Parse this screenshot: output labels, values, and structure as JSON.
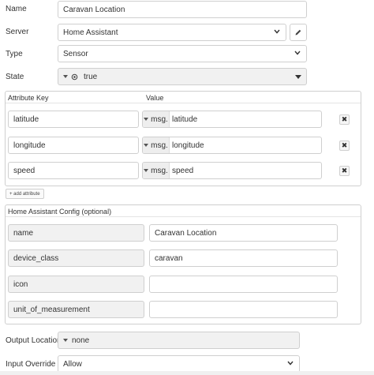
{
  "form": {
    "name_label": "Name",
    "name_value": "Caravan Location",
    "server_label": "Server",
    "server_value": "Home Assistant",
    "type_label": "Type",
    "type_value": "Sensor",
    "state_label": "State",
    "state_value": "true"
  },
  "attributes": {
    "col_key": "Attribute Key",
    "col_value": "Value",
    "rows": [
      {
        "key": "latitude",
        "type": "msg.",
        "value": "latitude"
      },
      {
        "key": "longitude",
        "type": "msg.",
        "value": "longitude"
      },
      {
        "key": "speed",
        "type": "msg.",
        "value": "speed"
      }
    ],
    "remove_glyph": "✖",
    "add_label": "+ add attribute"
  },
  "ha_config": {
    "title": "Home Assistant Config (optional)",
    "rows": [
      {
        "key": "name",
        "value": "Caravan Location"
      },
      {
        "key": "device_class",
        "value": "caravan"
      },
      {
        "key": "icon",
        "value": ""
      },
      {
        "key": "unit_of_measurement",
        "value": ""
      }
    ]
  },
  "output": {
    "location_label": "Output Location",
    "location_value": "none",
    "override_label": "Input Override",
    "override_value": "Allow"
  },
  "icons": {
    "edit": "pencil-icon",
    "state_type": "eye-icon"
  }
}
